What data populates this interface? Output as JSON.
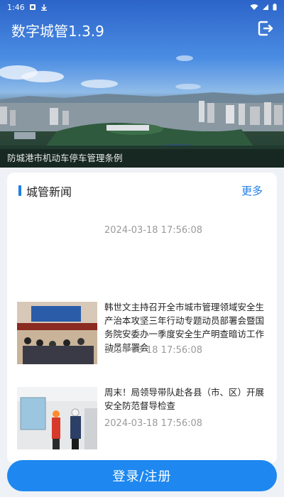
{
  "status_bar": {
    "time": "1:46"
  },
  "header": {
    "app_title": "数字城管1.3.9"
  },
  "banner": {
    "caption": "防城港市机动车停车管理条例"
  },
  "news": {
    "section_title": "城管新闻",
    "more_label": "更多",
    "items": [
      {
        "title": "",
        "date": "2024-03-18 17:56:08"
      },
      {
        "title": "韩世文主持召开全市城市管理领域安全生产治本攻坚三年行动专题动员部署会暨国务院安委办一季度安全生产明查暗访工作动员部署会",
        "date": "2024-03-18 17:56:08"
      },
      {
        "title": "周末！局领导带队赴各县（市、区）开展安全防范督导检查",
        "date": "2024-03-18 17:56:08"
      }
    ]
  },
  "login": {
    "label": "登录/注册"
  },
  "colors": {
    "accent": "#1e88f0",
    "link": "#1e7fe6"
  }
}
